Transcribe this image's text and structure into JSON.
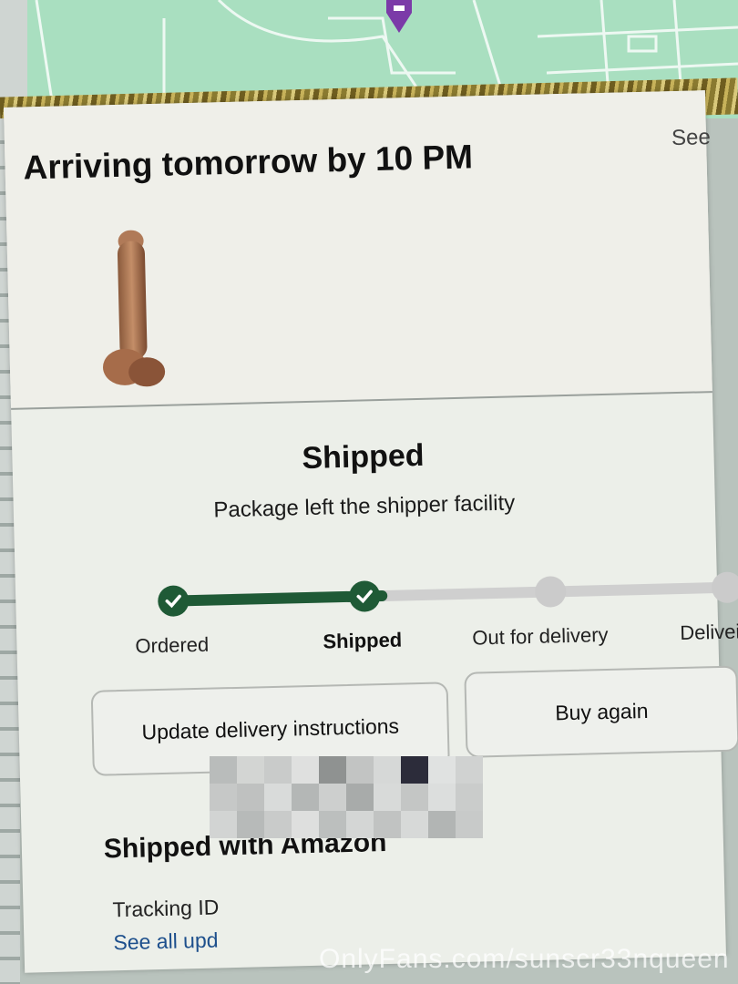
{
  "header": {
    "title": "Arriving tomorrow by 10 PM",
    "see_link": "See"
  },
  "status": {
    "title": "Shipped",
    "subtitle": "Package left the shipper facility",
    "progress_fraction": 0.4
  },
  "steps": [
    {
      "label": "Ordered",
      "state": "done"
    },
    {
      "label": "Shipped",
      "state": "done"
    },
    {
      "label": "Out for delivery",
      "state": "pending"
    },
    {
      "label": "Delivei",
      "state": "pending"
    }
  ],
  "actions": {
    "update_instructions": "Update delivery instructions",
    "buy_again": "Buy again"
  },
  "shipping": {
    "title": "Shipped with Amazon",
    "tracking_label": "Tracking ID",
    "see_all_updates": "See all upd"
  },
  "watermark": "OnlyFans.com/sunscr33nqueen",
  "colors": {
    "progress": "#1f5a36",
    "pending": "#cbcbcb",
    "link": "#1d4f8c",
    "map": "#a9dfc0"
  },
  "icons": {
    "map_pin": "map-pin-icon",
    "check": "check-icon"
  }
}
